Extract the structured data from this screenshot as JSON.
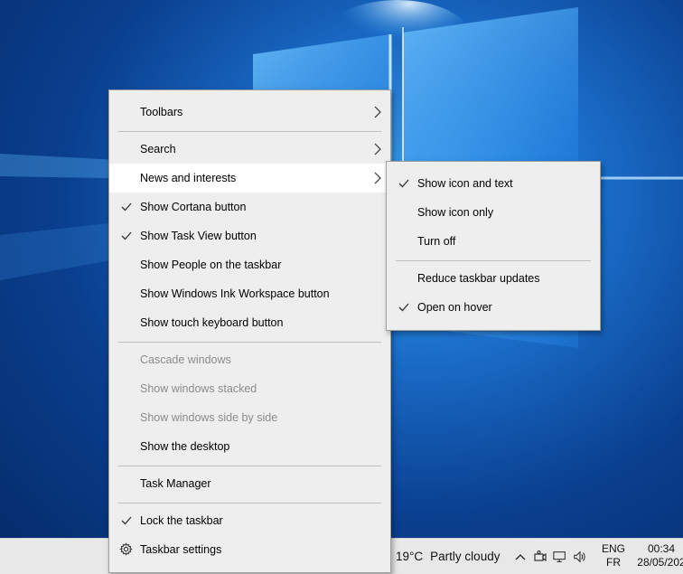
{
  "main_menu": {
    "items": [
      {
        "label": "Toolbars",
        "checked": false,
        "submenu": true,
        "disabled": false
      },
      {
        "label": "Search",
        "checked": false,
        "submenu": true,
        "disabled": false
      },
      {
        "label": "News and interests",
        "checked": false,
        "submenu": true,
        "disabled": false,
        "highlighted": true
      },
      {
        "label": "Show Cortana button",
        "checked": true,
        "submenu": false,
        "disabled": false
      },
      {
        "label": "Show Task View button",
        "checked": true,
        "submenu": false,
        "disabled": false
      },
      {
        "label": "Show People on the taskbar",
        "checked": false,
        "submenu": false,
        "disabled": false
      },
      {
        "label": "Show Windows Ink Workspace button",
        "checked": false,
        "submenu": false,
        "disabled": false
      },
      {
        "label": "Show touch keyboard button",
        "checked": false,
        "submenu": false,
        "disabled": false
      },
      {
        "label": "Cascade windows",
        "checked": false,
        "submenu": false,
        "disabled": true
      },
      {
        "label": "Show windows stacked",
        "checked": false,
        "submenu": false,
        "disabled": true
      },
      {
        "label": "Show windows side by side",
        "checked": false,
        "submenu": false,
        "disabled": true
      },
      {
        "label": "Show the desktop",
        "checked": false,
        "submenu": false,
        "disabled": false
      },
      {
        "label": "Task Manager",
        "checked": false,
        "submenu": false,
        "disabled": false
      },
      {
        "label": "Lock the taskbar",
        "checked": true,
        "submenu": false,
        "disabled": false
      },
      {
        "label": "Taskbar settings",
        "checked": false,
        "submenu": false,
        "disabled": false,
        "icon": "gear-icon"
      }
    ]
  },
  "sub_menu": {
    "items": [
      {
        "label": "Show icon and text",
        "checked": true
      },
      {
        "label": "Show icon only",
        "checked": false
      },
      {
        "label": "Turn off",
        "checked": false
      },
      {
        "label": "Reduce taskbar updates",
        "checked": false
      },
      {
        "label": "Open on hover",
        "checked": true
      }
    ]
  },
  "taskbar": {
    "temperature": "19°C",
    "weather": "Partly cloudy",
    "lang_top": "ENG",
    "lang_bottom": "FR",
    "time": "00:34",
    "date": "28/05/202",
    "tray_icons": [
      "chevron-up-icon",
      "meet-now-icon",
      "network-icon",
      "volume-icon"
    ]
  },
  "colors": {
    "menu_bg": "#eeeeee",
    "menu_hover": "#ffffff",
    "disabled_text": "#8c8c8c",
    "taskbar_bg": "#e8e8e8"
  }
}
